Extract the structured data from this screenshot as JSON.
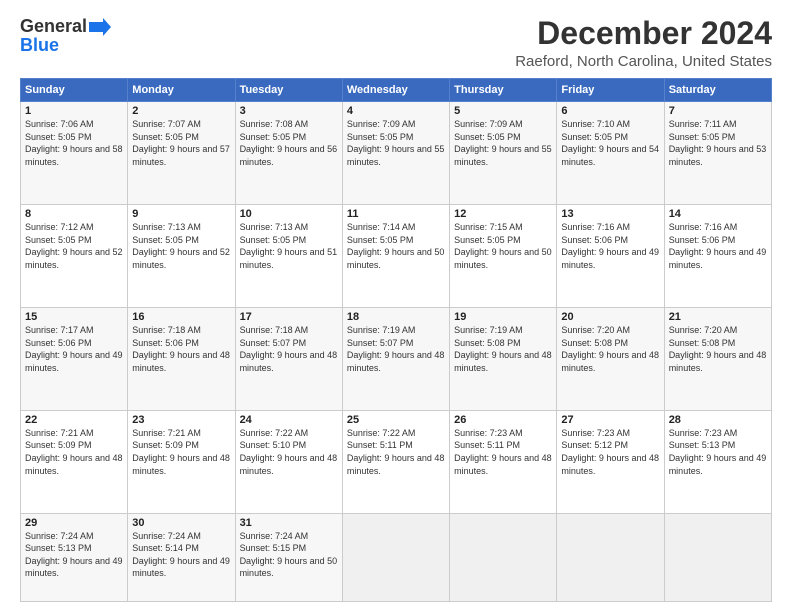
{
  "header": {
    "logo_line1": "General",
    "logo_line2": "Blue",
    "main_title": "December 2024",
    "subtitle": "Raeford, North Carolina, United States"
  },
  "calendar": {
    "days_of_week": [
      "Sunday",
      "Monday",
      "Tuesday",
      "Wednesday",
      "Thursday",
      "Friday",
      "Saturday"
    ],
    "weeks": [
      [
        {
          "day": "",
          "info": ""
        },
        {
          "day": "",
          "info": ""
        },
        {
          "day": "",
          "info": ""
        },
        {
          "day": "",
          "info": ""
        },
        {
          "day": "",
          "info": ""
        },
        {
          "day": "",
          "info": ""
        },
        {
          "day": "",
          "info": ""
        }
      ]
    ]
  },
  "days": {
    "w1": [
      {
        "num": "1",
        "sunrise": "7:06 AM",
        "sunset": "5:05 PM",
        "daylight": "9 hours and 58 minutes."
      },
      {
        "num": "2",
        "sunrise": "7:07 AM",
        "sunset": "5:05 PM",
        "daylight": "9 hours and 57 minutes."
      },
      {
        "num": "3",
        "sunrise": "7:08 AM",
        "sunset": "5:05 PM",
        "daylight": "9 hours and 56 minutes."
      },
      {
        "num": "4",
        "sunrise": "7:09 AM",
        "sunset": "5:05 PM",
        "daylight": "9 hours and 55 minutes."
      },
      {
        "num": "5",
        "sunrise": "7:09 AM",
        "sunset": "5:05 PM",
        "daylight": "9 hours and 55 minutes."
      },
      {
        "num": "6",
        "sunrise": "7:10 AM",
        "sunset": "5:05 PM",
        "daylight": "9 hours and 54 minutes."
      },
      {
        "num": "7",
        "sunrise": "7:11 AM",
        "sunset": "5:05 PM",
        "daylight": "9 hours and 53 minutes."
      }
    ],
    "w2": [
      {
        "num": "8",
        "sunrise": "7:12 AM",
        "sunset": "5:05 PM",
        "daylight": "9 hours and 52 minutes."
      },
      {
        "num": "9",
        "sunrise": "7:13 AM",
        "sunset": "5:05 PM",
        "daylight": "9 hours and 52 minutes."
      },
      {
        "num": "10",
        "sunrise": "7:13 AM",
        "sunset": "5:05 PM",
        "daylight": "9 hours and 51 minutes."
      },
      {
        "num": "11",
        "sunrise": "7:14 AM",
        "sunset": "5:05 PM",
        "daylight": "9 hours and 50 minutes."
      },
      {
        "num": "12",
        "sunrise": "7:15 AM",
        "sunset": "5:05 PM",
        "daylight": "9 hours and 50 minutes."
      },
      {
        "num": "13",
        "sunrise": "7:16 AM",
        "sunset": "5:06 PM",
        "daylight": "9 hours and 49 minutes."
      },
      {
        "num": "14",
        "sunrise": "7:16 AM",
        "sunset": "5:06 PM",
        "daylight": "9 hours and 49 minutes."
      }
    ],
    "w3": [
      {
        "num": "15",
        "sunrise": "7:17 AM",
        "sunset": "5:06 PM",
        "daylight": "9 hours and 49 minutes."
      },
      {
        "num": "16",
        "sunrise": "7:18 AM",
        "sunset": "5:06 PM",
        "daylight": "9 hours and 48 minutes."
      },
      {
        "num": "17",
        "sunrise": "7:18 AM",
        "sunset": "5:07 PM",
        "daylight": "9 hours and 48 minutes."
      },
      {
        "num": "18",
        "sunrise": "7:19 AM",
        "sunset": "5:07 PM",
        "daylight": "9 hours and 48 minutes."
      },
      {
        "num": "19",
        "sunrise": "7:19 AM",
        "sunset": "5:08 PM",
        "daylight": "9 hours and 48 minutes."
      },
      {
        "num": "20",
        "sunrise": "7:20 AM",
        "sunset": "5:08 PM",
        "daylight": "9 hours and 48 minutes."
      },
      {
        "num": "21",
        "sunrise": "7:20 AM",
        "sunset": "5:08 PM",
        "daylight": "9 hours and 48 minutes."
      }
    ],
    "w4": [
      {
        "num": "22",
        "sunrise": "7:21 AM",
        "sunset": "5:09 PM",
        "daylight": "9 hours and 48 minutes."
      },
      {
        "num": "23",
        "sunrise": "7:21 AM",
        "sunset": "5:09 PM",
        "daylight": "9 hours and 48 minutes."
      },
      {
        "num": "24",
        "sunrise": "7:22 AM",
        "sunset": "5:10 PM",
        "daylight": "9 hours and 48 minutes."
      },
      {
        "num": "25",
        "sunrise": "7:22 AM",
        "sunset": "5:11 PM",
        "daylight": "9 hours and 48 minutes."
      },
      {
        "num": "26",
        "sunrise": "7:23 AM",
        "sunset": "5:11 PM",
        "daylight": "9 hours and 48 minutes."
      },
      {
        "num": "27",
        "sunrise": "7:23 AM",
        "sunset": "5:12 PM",
        "daylight": "9 hours and 48 minutes."
      },
      {
        "num": "28",
        "sunrise": "7:23 AM",
        "sunset": "5:13 PM",
        "daylight": "9 hours and 49 minutes."
      }
    ],
    "w5": [
      {
        "num": "29",
        "sunrise": "7:24 AM",
        "sunset": "5:13 PM",
        "daylight": "9 hours and 49 minutes."
      },
      {
        "num": "30",
        "sunrise": "7:24 AM",
        "sunset": "5:14 PM",
        "daylight": "9 hours and 49 minutes."
      },
      {
        "num": "31",
        "sunrise": "7:24 AM",
        "sunset": "5:15 PM",
        "daylight": "9 hours and 50 minutes."
      },
      {
        "num": "",
        "sunrise": "",
        "sunset": "",
        "daylight": ""
      },
      {
        "num": "",
        "sunrise": "",
        "sunset": "",
        "daylight": ""
      },
      {
        "num": "",
        "sunrise": "",
        "sunset": "",
        "daylight": ""
      },
      {
        "num": "",
        "sunrise": "",
        "sunset": "",
        "daylight": ""
      }
    ]
  },
  "labels": {
    "sunrise_prefix": "Sunrise: ",
    "sunset_prefix": "Sunset: ",
    "daylight_prefix": "Daylight: "
  }
}
